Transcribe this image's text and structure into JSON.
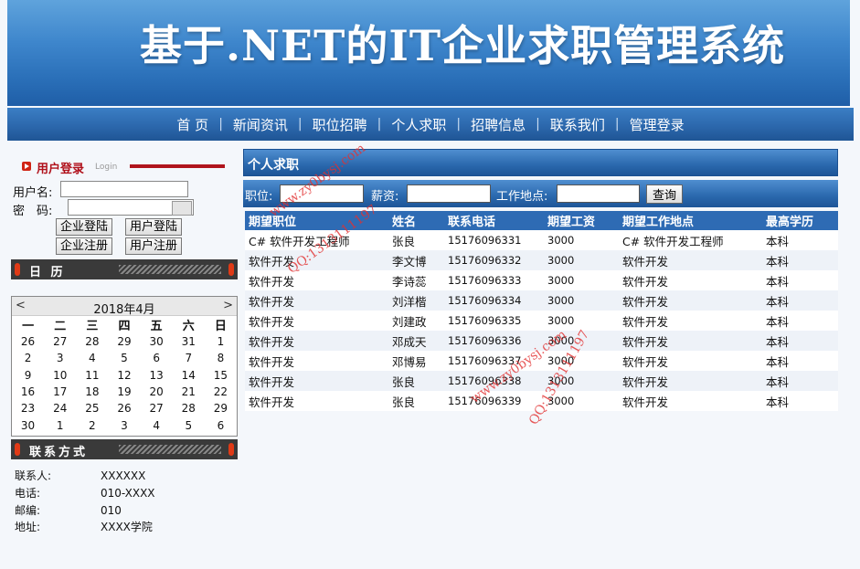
{
  "banner": {
    "title": "基于.NET的IT企业求职管理系统"
  },
  "nav": [
    "首 页",
    "新闻资讯",
    "职位招聘",
    "个人求职",
    "招聘信息",
    "联系我们",
    "管理登录"
  ],
  "login": {
    "title": "用户登录",
    "subtitle": "Login",
    "username_label": "用户名:",
    "password_label": "密　码:",
    "buttons": {
      "company_login": "企业登陆",
      "user_login": "用户登陆",
      "company_register": "企业注册",
      "user_register": "用户注册"
    }
  },
  "calendar": {
    "title": "日 历",
    "month": "2018年4月",
    "prev": "<",
    "next": ">",
    "weekdays": [
      "一",
      "二",
      "三",
      "四",
      "五",
      "六",
      "日"
    ],
    "weeks": [
      [
        "26",
        "27",
        "28",
        "29",
        "30",
        "31",
        "1"
      ],
      [
        "2",
        "3",
        "4",
        "5",
        "6",
        "7",
        "8"
      ],
      [
        "9",
        "10",
        "11",
        "12",
        "13",
        "14",
        "15"
      ],
      [
        "16",
        "17",
        "18",
        "19",
        "20",
        "21",
        "22"
      ],
      [
        "23",
        "24",
        "25",
        "26",
        "27",
        "28",
        "29"
      ],
      [
        "30",
        "1",
        "2",
        "3",
        "4",
        "5",
        "6"
      ]
    ]
  },
  "contact": {
    "title": "联系方式",
    "rows": [
      {
        "k": "联系人:",
        "v": "XXXXXX"
      },
      {
        "k": "电话:",
        "v": "010-XXXX"
      },
      {
        "k": "邮编:",
        "v": "010"
      },
      {
        "k": "地址:",
        "v": "XXXX学院"
      }
    ]
  },
  "section": {
    "title": "个人求职"
  },
  "search": {
    "position_label": "职位:",
    "salary_label": "薪资:",
    "location_label": "工作地点:",
    "button": "查询"
  },
  "table": {
    "headers": [
      "期望职位",
      "姓名",
      "联系电话",
      "期望工资",
      "期望工作地点",
      "最高学历"
    ],
    "rows": [
      [
        "C# 软件开发工程师",
        "张良",
        "15176096331",
        "3000",
        "C# 软件开发工程师",
        "本科"
      ],
      [
        "软件开发",
        "李文博",
        "15176096332",
        "3000",
        "软件开发",
        "本科"
      ],
      [
        "软件开发",
        "李诗蕊",
        "15176096333",
        "3000",
        "软件开发",
        "本科"
      ],
      [
        "软件开发",
        "刘洋楷",
        "15176096334",
        "3000",
        "软件开发",
        "本科"
      ],
      [
        "软件开发",
        "刘建政",
        "15176096335",
        "3000",
        "软件开发",
        "本科"
      ],
      [
        "软件开发",
        "邓成天",
        "15176096336",
        "3000",
        "软件开发",
        "本科"
      ],
      [
        "软件开发",
        "邓博易",
        "15176096337",
        "3000",
        "软件开发",
        "本科"
      ],
      [
        "软件开发",
        "张良",
        "15176096338",
        "3000",
        "软件开发",
        "本科"
      ],
      [
        "软件开发",
        "张良",
        "15176096339",
        "3000",
        "软件开发",
        "本科"
      ]
    ]
  },
  "watermarks": [
    "www.zy0bysj.com",
    "QQ:1313111197",
    "www.zy0bysj.com",
    "QQ:1313111197"
  ]
}
